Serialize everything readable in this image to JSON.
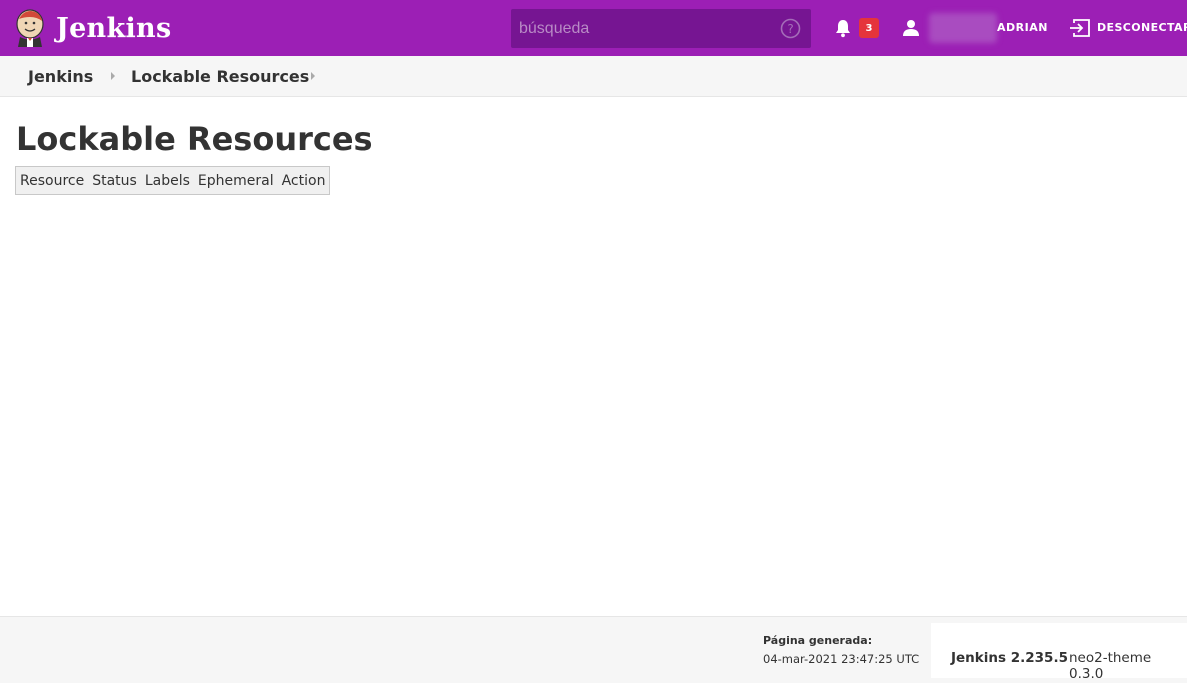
{
  "header": {
    "app_name": "Jenkins",
    "search_placeholder": "búsqueda",
    "notification_count": "3",
    "user_name": "ADRIAN",
    "logout_label": "DESCONECTAR",
    "accent_color": "#9c1fb5",
    "badge_color": "#e5343b"
  },
  "breadcrumb": {
    "items": [
      {
        "label": "Jenkins"
      },
      {
        "label": "Lockable Resources"
      }
    ]
  },
  "main": {
    "title": "Lockable Resources",
    "table": {
      "columns": [
        "Resource",
        "Status",
        "Labels",
        "Ephemeral",
        "Action"
      ],
      "rows": []
    }
  },
  "footer": {
    "generated_label": "Página generada:",
    "generated_date": "04-mar-2021 23:47:25 UTC",
    "jenkins_version": "Jenkins 2.235.5",
    "theme_version": "neo2-theme 0.3.0"
  },
  "icons": [
    "jenkins-logo-icon",
    "help-icon",
    "bell-icon",
    "user-icon",
    "logout-icon"
  ]
}
